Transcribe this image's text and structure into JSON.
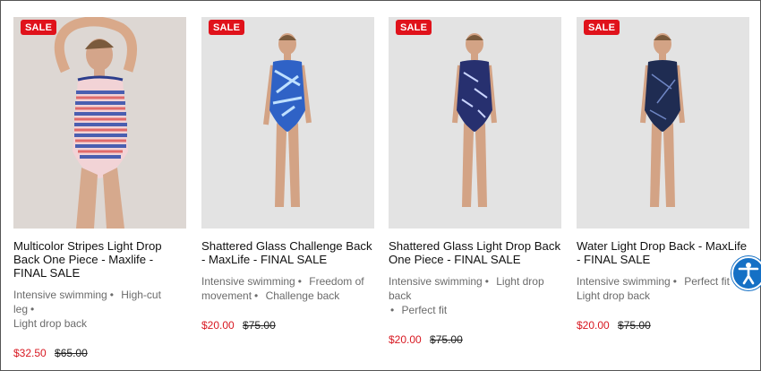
{
  "products": [
    {
      "badge": "SALE",
      "title": "Multicolor Stripes Light Drop Back One Piece - Maxlife - FINAL SALE",
      "tags": [
        "Intensive swimming",
        "High-cut leg",
        "Light drop back"
      ],
      "sale_price": "$32.50",
      "original_price": "$65.00"
    },
    {
      "badge": "SALE",
      "title": "Shattered Glass Challenge Back - MaxLife - FINAL SALE",
      "tags": [
        "Intensive swimming",
        "Freedom of movement",
        "Challenge back"
      ],
      "sale_price": "$20.00",
      "original_price": "$75.00"
    },
    {
      "badge": "SALE",
      "title": "Shattered Glass Light Drop Back One Piece - FINAL SALE",
      "tags": [
        "Intensive swimming",
        "Light drop back",
        "Perfect fit"
      ],
      "sale_price": "$20.00",
      "original_price": "$75.00"
    },
    {
      "badge": "SALE",
      "title": "Water Light Drop Back - MaxLife - FINAL SALE",
      "tags": [
        "Intensive swimming",
        "Perfect fit",
        "Light drop back"
      ],
      "sale_price": "$20.00",
      "original_price": "$75.00"
    }
  ],
  "colors": {
    "badge": "#e0121b",
    "sale_price": "#d81922",
    "accessibility": "#1570c5"
  },
  "icons": {
    "accessibility": "accessibility-icon"
  }
}
